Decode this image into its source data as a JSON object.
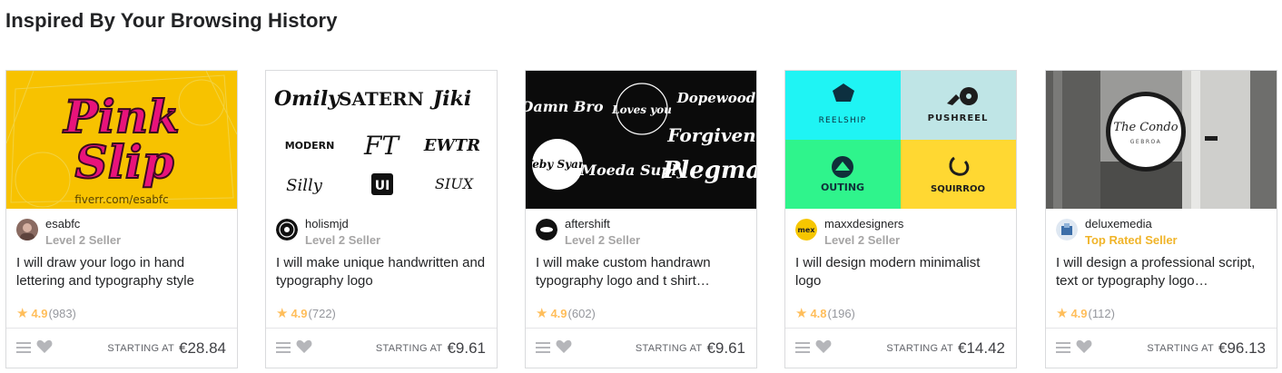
{
  "section": {
    "title": "Inspired By Your Browsing History"
  },
  "colors": {
    "star": "#ffbe5b",
    "top_rated": "#f0b429",
    "level_text": "#a6a5a5",
    "border": "#dadbdd"
  },
  "icons": {
    "rating": "star-icon",
    "collect": "list-icon",
    "favorite": "heart-icon"
  },
  "cards": [
    {
      "seller": "esabfc",
      "level": "Level 2 Seller",
      "title": "I will draw your logo in hand lettering and typography style",
      "rating": "4.9",
      "reviews": "(983)",
      "starting_label": "STARTING AT",
      "price": "€28.84",
      "thumb_text": {
        "line1": "Pink",
        "line2": "Slip",
        "footer": "fiverr.com/esabfc"
      }
    },
    {
      "seller": "holismjd",
      "level": "Level 2 Seller",
      "title": "I will make unique handwritten and typography logo",
      "rating": "4.9",
      "reviews": "(722)",
      "starting_label": "STARTING AT",
      "price": "€9.61",
      "thumb_text": {
        "logo1": "Omily",
        "logo2": "SATERN",
        "logo3": "Jiki",
        "logo4": "MODERN",
        "logo5": "FT",
        "logo6": "EWTR",
        "logo7": "Silly",
        "logo8": "UI",
        "logo9": "SIUX"
      }
    },
    {
      "seller": "aftershift",
      "level": "Level 2 Seller",
      "title": "I will make custom handrawn typography logo and t shirt…",
      "rating": "4.9",
      "reviews": "(602)",
      "starting_label": "STARTING AT",
      "price": "€9.61",
      "thumb_text": {
        "logo1": "Damn Bro",
        "logo2": "Loves you",
        "logo3": "Dopewood",
        "logo4": "Forgiven",
        "logo5": "Feby Syam",
        "logo6": "Moeda Suply",
        "logo7": "Plegma"
      }
    },
    {
      "seller": "maxxdesigners",
      "level": "Level 2 Seller",
      "title": "I will design modern minimalist logo",
      "rating": "4.8",
      "reviews": "(196)",
      "starting_label": "STARTING AT",
      "price": "€14.42",
      "thumb_text": {
        "q1": "REELSHIP",
        "q2": "PUSHREEL",
        "q3": "OUTING",
        "q4": "SQUIRROO",
        "avatar": "mex"
      }
    },
    {
      "seller": "deluxemedia",
      "level": "Top Rated Seller",
      "title": "I will design a professional script, text or typography logo…",
      "rating": "4.9",
      "reviews": "(112)",
      "starting_label": "STARTING AT",
      "price": "€96.13",
      "thumb_text": {
        "sign1": "The Condo",
        "sign2": "GEBROA"
      }
    }
  ]
}
